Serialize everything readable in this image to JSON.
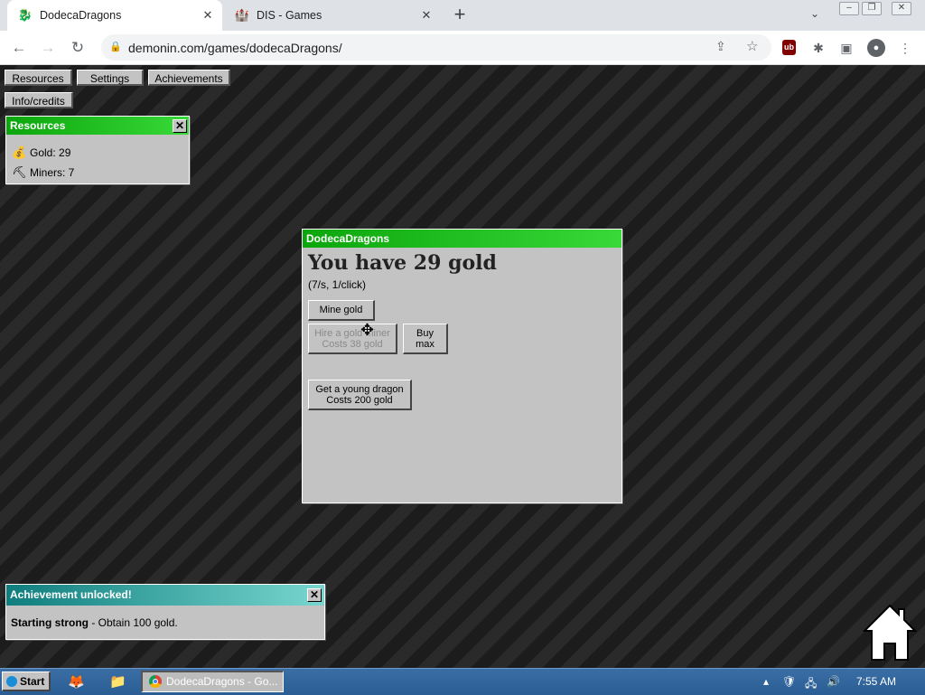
{
  "browser": {
    "tabs": [
      {
        "title": "DodecaDragons",
        "icon": "dragon-favicon",
        "active": true
      },
      {
        "title": "DIS - Games",
        "icon": "dis-favicon",
        "active": false
      }
    ],
    "url": "demonin.com/games/dodecaDragons/"
  },
  "menu": {
    "resources_label": "Resources",
    "settings_label": "Settings",
    "achievements_label": "Achievements",
    "info_label": "Info/credits"
  },
  "resources_panel": {
    "title": "Resources",
    "close_label": "✕",
    "items": [
      {
        "label": "Gold: 29",
        "icon": "gold-icon"
      },
      {
        "label": "Miners: 7",
        "icon": "miner-icon"
      }
    ]
  },
  "game_window": {
    "title": "DodecaDragons",
    "headline": "You have 29 gold",
    "rate": "(7/s, 1/click)",
    "mine_button": "Mine gold",
    "hire_button": [
      "Hire a gold miner",
      "Costs 38 gold"
    ],
    "buy_max_button": [
      "Buy",
      "max"
    ],
    "dragon_button": [
      "Get a young dragon",
      "Costs 200 gold"
    ]
  },
  "achievement_popup": {
    "title": "Achievement unlocked!",
    "name": "Starting strong",
    "description": " - Obtain 100 gold.",
    "close_label": "✕"
  },
  "taskbar": {
    "start_label": "Start",
    "task_label": "DodecaDragons - Go...",
    "time": "7:55 AM"
  },
  "colors": {
    "title_green": "#0ca60c",
    "title_teal": "#0f7e7e",
    "panel_gray": "#c3c3c3",
    "taskbar_blue": "#3a6ea5"
  }
}
